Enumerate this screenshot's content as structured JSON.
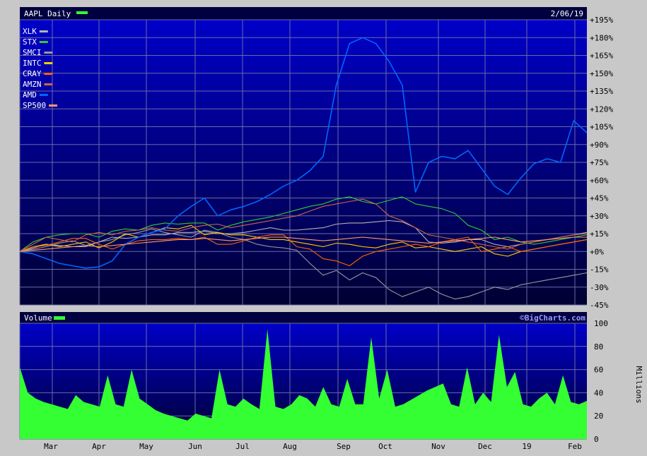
{
  "header": {
    "symbol_label": "AAPL Daily",
    "date": "2/06/19",
    "symbol_color": "#33ff33"
  },
  "volume_panel": {
    "title": "Volume",
    "watermark": "©BigCharts.com",
    "units_label": "Millions",
    "fill_color": "#33ff33"
  },
  "theme": {
    "frame": "#c8c8c8",
    "plot_top": "#0000c8",
    "plot_bottom": "#000033",
    "grid": "#6a6aaa",
    "text": "#ffffff",
    "axis_text": "#000000"
  },
  "chart_data": [
    {
      "type": "line",
      "title": "AAPL Daily",
      "x_tick_labels": [
        "Mar",
        "Apr",
        "May",
        "Jun",
        "Jul",
        "Aug",
        "Sep",
        "Oct",
        "Nov",
        "Dec",
        "19",
        "Feb"
      ],
      "y_tick_labels": [
        "+195%",
        "+180%",
        "+165%",
        "+150%",
        "+135%",
        "+120%",
        "+105%",
        "+90%",
        "+75%",
        "+60%",
        "+45%",
        "+30%",
        "+15%",
        "+0%",
        "-15%",
        "-30%",
        "-45%"
      ],
      "ylim": [
        -45,
        195
      ],
      "y_unit": "%",
      "grid": true,
      "legend_position": "top-left",
      "series": [
        {
          "name": "XLK",
          "color": "#b4b4b4",
          "values": [
            0,
            3,
            6,
            5,
            4,
            4,
            8,
            12,
            11,
            12,
            14,
            14,
            16,
            16,
            17,
            15,
            15,
            16,
            18,
            20,
            18,
            18,
            19,
            20,
            23,
            24,
            24,
            25,
            26,
            25,
            20,
            8,
            7,
            8,
            10,
            10,
            6,
            4,
            6,
            8,
            10,
            12,
            14,
            16
          ]
        },
        {
          "name": "STX",
          "color": "#33cc33",
          "values": [
            0,
            8,
            12,
            14,
            15,
            15,
            12,
            17,
            19,
            18,
            22,
            24,
            23,
            24,
            24,
            18,
            22,
            25,
            27,
            29,
            32,
            35,
            38,
            40,
            44,
            46,
            42,
            40,
            43,
            46,
            40,
            38,
            36,
            32,
            22,
            18,
            10,
            12,
            8,
            6,
            8,
            10,
            12,
            14
          ]
        },
        {
          "name": "SMCI",
          "color": "#999999",
          "values": [
            0,
            2,
            4,
            7,
            9,
            5,
            8,
            10,
            14,
            16,
            19,
            16,
            14,
            12,
            18,
            16,
            12,
            10,
            6,
            4,
            3,
            1,
            -10,
            -20,
            -16,
            -24,
            -18,
            -22,
            -32,
            -38,
            -34,
            -30,
            -36,
            -40,
            -38,
            -34,
            -30,
            -32,
            -28,
            -26,
            -24,
            -22,
            -20,
            -18
          ]
        },
        {
          "name": "INTC",
          "color": "#ffcc00",
          "values": [
            0,
            4,
            6,
            4,
            6,
            8,
            3,
            8,
            15,
            12,
            16,
            20,
            19,
            22,
            14,
            16,
            14,
            14,
            12,
            10,
            10,
            8,
            6,
            4,
            7,
            6,
            4,
            3,
            6,
            8,
            3,
            4,
            2,
            0,
            2,
            4,
            -2,
            -4,
            0,
            2,
            4,
            6,
            8,
            10
          ]
        },
        {
          "name": "CRAY",
          "color": "#ff6600",
          "values": [
            0,
            4,
            5,
            8,
            11,
            11,
            6,
            2,
            6,
            9,
            10,
            10,
            11,
            10,
            12,
            6,
            6,
            9,
            12,
            14,
            14,
            4,
            2,
            -6,
            -8,
            -12,
            -4,
            0,
            2,
            4,
            6,
            4,
            8,
            10,
            12,
            0,
            2,
            4,
            0,
            2,
            4,
            6,
            8,
            10
          ]
        },
        {
          "name": "AMZN",
          "color": "#cc6644",
          "values": [
            0,
            6,
            12,
            10,
            8,
            14,
            16,
            14,
            17,
            18,
            20,
            18,
            17,
            20,
            22,
            23,
            20,
            22,
            24,
            26,
            28,
            30,
            34,
            38,
            40,
            42,
            44,
            40,
            30,
            26,
            20,
            14,
            12,
            10,
            8,
            6,
            4,
            2,
            6,
            8,
            10,
            12,
            14,
            15
          ]
        },
        {
          "name": "AMD",
          "color": "#0066ff",
          "values": [
            0,
            -2,
            -6,
            -10,
            -12,
            -14,
            -13,
            -8,
            6,
            12,
            16,
            19,
            30,
            38,
            45,
            30,
            35,
            38,
            42,
            48,
            55,
            60,
            68,
            80,
            140,
            175,
            180,
            175,
            160,
            140,
            50,
            75,
            80,
            78,
            85,
            70,
            55,
            48,
            62,
            74,
            78,
            75,
            110,
            100
          ]
        },
        {
          "name": "SP500",
          "color": "#ff9966",
          "values": [
            0,
            1,
            2,
            3,
            4,
            5,
            4,
            5,
            6,
            7,
            8,
            9,
            10,
            10,
            11,
            10,
            9,
            10,
            11,
            12,
            12,
            11,
            10,
            9,
            10,
            11,
            12,
            11,
            10,
            9,
            8,
            7,
            8,
            9,
            10,
            11,
            12,
            10,
            8,
            9,
            10,
            11,
            12,
            12
          ]
        }
      ]
    },
    {
      "type": "area",
      "title": "Volume",
      "ylabel": "Millions",
      "ylim": [
        0,
        100
      ],
      "y_tick_labels": [
        "100",
        "80",
        "60",
        "40",
        "20",
        "0"
      ],
      "x_tick_labels": [
        "Mar",
        "Apr",
        "May",
        "Jun",
        "Jul",
        "Aug",
        "Sep",
        "Oct",
        "Nov",
        "Dec",
        "19",
        "Feb"
      ],
      "values": [
        62,
        40,
        35,
        32,
        30,
        28,
        26,
        38,
        32,
        30,
        28,
        55,
        30,
        28,
        60,
        35,
        30,
        25,
        22,
        20,
        18,
        16,
        22,
        20,
        18,
        60,
        30,
        28,
        35,
        30,
        26,
        95,
        28,
        26,
        30,
        38,
        35,
        28,
        45,
        30,
        28,
        52,
        30,
        30,
        88,
        35,
        60,
        28,
        30,
        34,
        38,
        42,
        45,
        48,
        30,
        28,
        62,
        30,
        40,
        32,
        90,
        45,
        58,
        30,
        28,
        35,
        40,
        30,
        55,
        32,
        30,
        33
      ]
    }
  ]
}
